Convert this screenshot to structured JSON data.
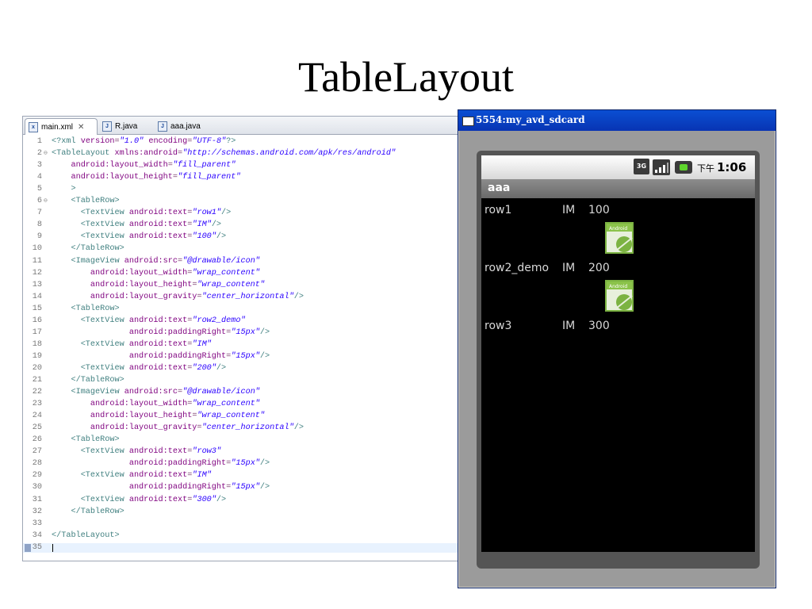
{
  "slide": {
    "title": "TableLayout"
  },
  "editor": {
    "tabs": [
      {
        "label": "main.xml",
        "icon": "xml-file-icon",
        "active": true
      },
      {
        "label": "R.java",
        "icon": "java-file-icon",
        "active": false
      },
      {
        "label": "aaa.java",
        "icon": "java-file-icon",
        "active": false
      }
    ],
    "lines": [
      {
        "num": "1",
        "text": "<?xml version=\"1.0\" encoding=\"UTF-8\"?>"
      },
      {
        "num": "2",
        "text": "<TableLayout xmlns:android=\"http://schemas.android.com/apk/res/android\""
      },
      {
        "num": "3",
        "text": "    android:layout_width=\"fill_parent\""
      },
      {
        "num": "4",
        "text": "    android:layout_height=\"fill_parent\""
      },
      {
        "num": "5",
        "text": "    >"
      },
      {
        "num": "6",
        "text": "    <TableRow>"
      },
      {
        "num": "7",
        "text": "      <TextView android:text=\"row1\"/>"
      },
      {
        "num": "8",
        "text": "      <TextView android:text=\"IM\"/>"
      },
      {
        "num": "9",
        "text": "      <TextView android:text=\"100\"/>"
      },
      {
        "num": "10",
        "text": "    </TableRow>"
      },
      {
        "num": "11",
        "text": "    <ImageView android:src=\"@drawable/icon\""
      },
      {
        "num": "12",
        "text": "        android:layout_width=\"wrap_content\""
      },
      {
        "num": "13",
        "text": "        android:layout_height=\"wrap_content\""
      },
      {
        "num": "14",
        "text": "        android:layout_gravity=\"center_horizontal\"/>"
      },
      {
        "num": "15",
        "text": "    <TableRow>"
      },
      {
        "num": "16",
        "text": "      <TextView android:text=\"row2_demo\""
      },
      {
        "num": "17",
        "text": "                android:paddingRight=\"15px\"/>"
      },
      {
        "num": "18",
        "text": "      <TextView android:text=\"IM\""
      },
      {
        "num": "19",
        "text": "                android:paddingRight=\"15px\"/>"
      },
      {
        "num": "20",
        "text": "      <TextView android:text=\"200\"/>"
      },
      {
        "num": "21",
        "text": "    </TableRow>"
      },
      {
        "num": "22",
        "text": "    <ImageView android:src=\"@drawable/icon\""
      },
      {
        "num": "23",
        "text": "        android:layout_width=\"wrap_content\""
      },
      {
        "num": "24",
        "text": "        android:layout_height=\"wrap_content\""
      },
      {
        "num": "25",
        "text": "        android:layout_gravity=\"center_horizontal\"/>"
      },
      {
        "num": "26",
        "text": "    <TableRow>"
      },
      {
        "num": "27",
        "text": "      <TextView android:text=\"row3\""
      },
      {
        "num": "28",
        "text": "                android:paddingRight=\"15px\"/>"
      },
      {
        "num": "29",
        "text": "      <TextView android:text=\"IM\""
      },
      {
        "num": "30",
        "text": "                android:paddingRight=\"15px\"/>"
      },
      {
        "num": "31",
        "text": "      <TextView android:text=\"300\"/>"
      },
      {
        "num": "32",
        "text": "    </TableRow>"
      },
      {
        "num": "33",
        "text": ""
      },
      {
        "num": "34",
        "text": "</TableLayout>"
      },
      {
        "num": "35",
        "text": ""
      }
    ]
  },
  "emulator": {
    "window_title": "5554:my_avd_sdcard",
    "status_bar": {
      "network": "3G",
      "time_prefix": "下午",
      "time": "1:06"
    },
    "app_title": "aaa",
    "rows": [
      {
        "col1": "row1",
        "col2": "IM",
        "col3": "100"
      },
      {
        "col1": "row2_demo",
        "col2": "IM",
        "col3": "200"
      },
      {
        "col1": "row3",
        "col2": "IM",
        "col3": "300"
      }
    ],
    "icon_label": "Android"
  },
  "colors": {
    "xml_tag": "#3f7f7f",
    "xml_attr": "#7f007f",
    "xml_value": "#2a00ff",
    "titlebar": "#0a4fd3"
  }
}
